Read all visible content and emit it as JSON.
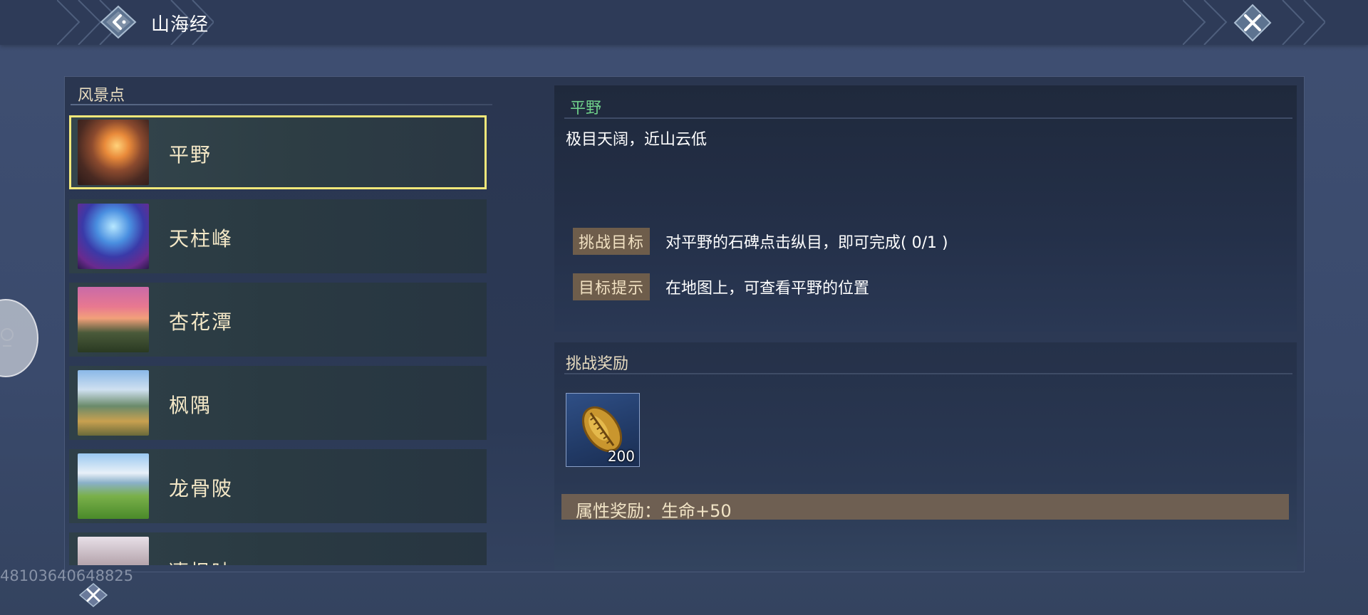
{
  "header": {
    "title": "山海经",
    "back_icon": "back-arrow-icon",
    "close_icon": "close-icon"
  },
  "list": {
    "header": "风景点",
    "items": [
      {
        "label": "平野",
        "selected": true
      },
      {
        "label": "天柱峰",
        "selected": false
      },
      {
        "label": "杏花潭",
        "selected": false
      },
      {
        "label": "枫隅",
        "selected": false
      },
      {
        "label": "龙骨陂",
        "selected": false
      },
      {
        "label": "凄枫映",
        "selected": false
      }
    ]
  },
  "detail": {
    "title": "平野",
    "description": "极目天阔，近山云低",
    "goal_tag": "挑战目标",
    "goal_text": "对平野的石碑点击纵目，即可完成( 0/1 )",
    "hint_tag": "目标提示",
    "hint_text": "在地图上，可查看平野的位置"
  },
  "reward": {
    "title": "挑战奖励",
    "item_icon": "shell-coin-icon",
    "item_qty": "200",
    "attr_text": "属性奖励：生命+50"
  },
  "watermark": "48103640648825",
  "colors": {
    "accent_green": "#6fd08a",
    "selected_border": "#f2e87a",
    "tag_bg": "#6e5d4b"
  }
}
